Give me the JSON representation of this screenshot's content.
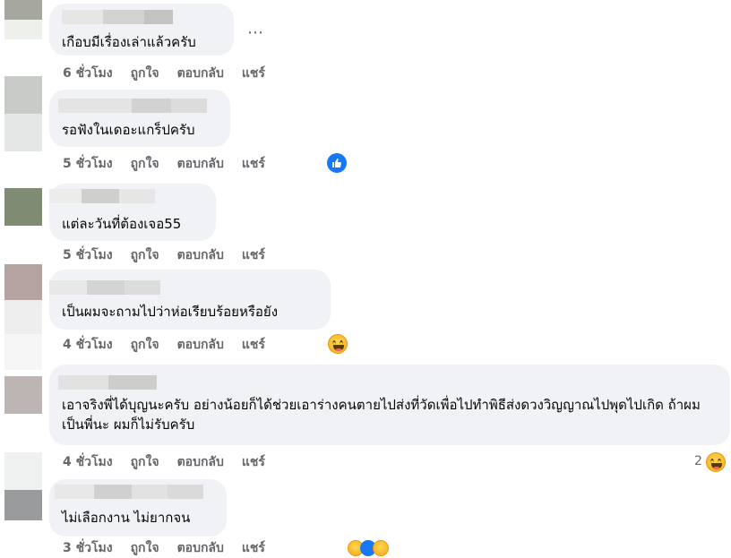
{
  "comments": [
    {
      "text": "เกือบมีเรื่องเล่าแล้วครับ",
      "time": "6 ชั่วโมง",
      "like": "ถูกใจ",
      "reply": "ตอบกลับ",
      "share": "แชร์",
      "more_icon": "⋯"
    },
    {
      "text": "รอฟังในเดอะแกร็ปครับ",
      "time": "5 ชั่วโมง",
      "like": "ถูกใจ",
      "reply": "ตอบกลับ",
      "share": "แชร์",
      "reaction": "like-icon"
    },
    {
      "text": "แต่ละวันที่ต้องเจอ55",
      "time": "5 ชั่วโมง",
      "like": "ถูกใจ",
      "reply": "ตอบกลับ",
      "share": "แชร์"
    },
    {
      "text": "เป็นผมจะถามไปว่าห่อเรียบร้อยหรือยัง",
      "time": "4 ชั่วโมง",
      "like": "ถูกใจ",
      "reply": "ตอบกลับ",
      "share": "แชร์",
      "reaction": "haha-icon"
    },
    {
      "text": "เอาจริงพี่ได้บุญนะครับ อย่างน้อยก็ได้ช่วยเอาร่างคนตายไปส่งที่วัดเพื่อไปทำพิธีส่งดวงวิญญาณไปพุดไปเกิด ถ้าผมเป็นพี่นะ ผมก็ไม่รับครับ",
      "time": "4 ชั่วโมง",
      "like": "ถูกใจ",
      "reply": "ตอบกลับ",
      "share": "แชร์",
      "reaction": "haha-icon",
      "reaction_count": "2"
    },
    {
      "text": "ไม่เลือกงาน ไม่ยากจน",
      "time": "3 ชั่วโมง",
      "like": "ถูกใจ",
      "reply": "ตอบกลับ",
      "share": "แชร์"
    }
  ],
  "colors": {
    "bubble": "#f0f2f5",
    "meta_text": "#65676b",
    "like_blue": "#1877f2"
  }
}
